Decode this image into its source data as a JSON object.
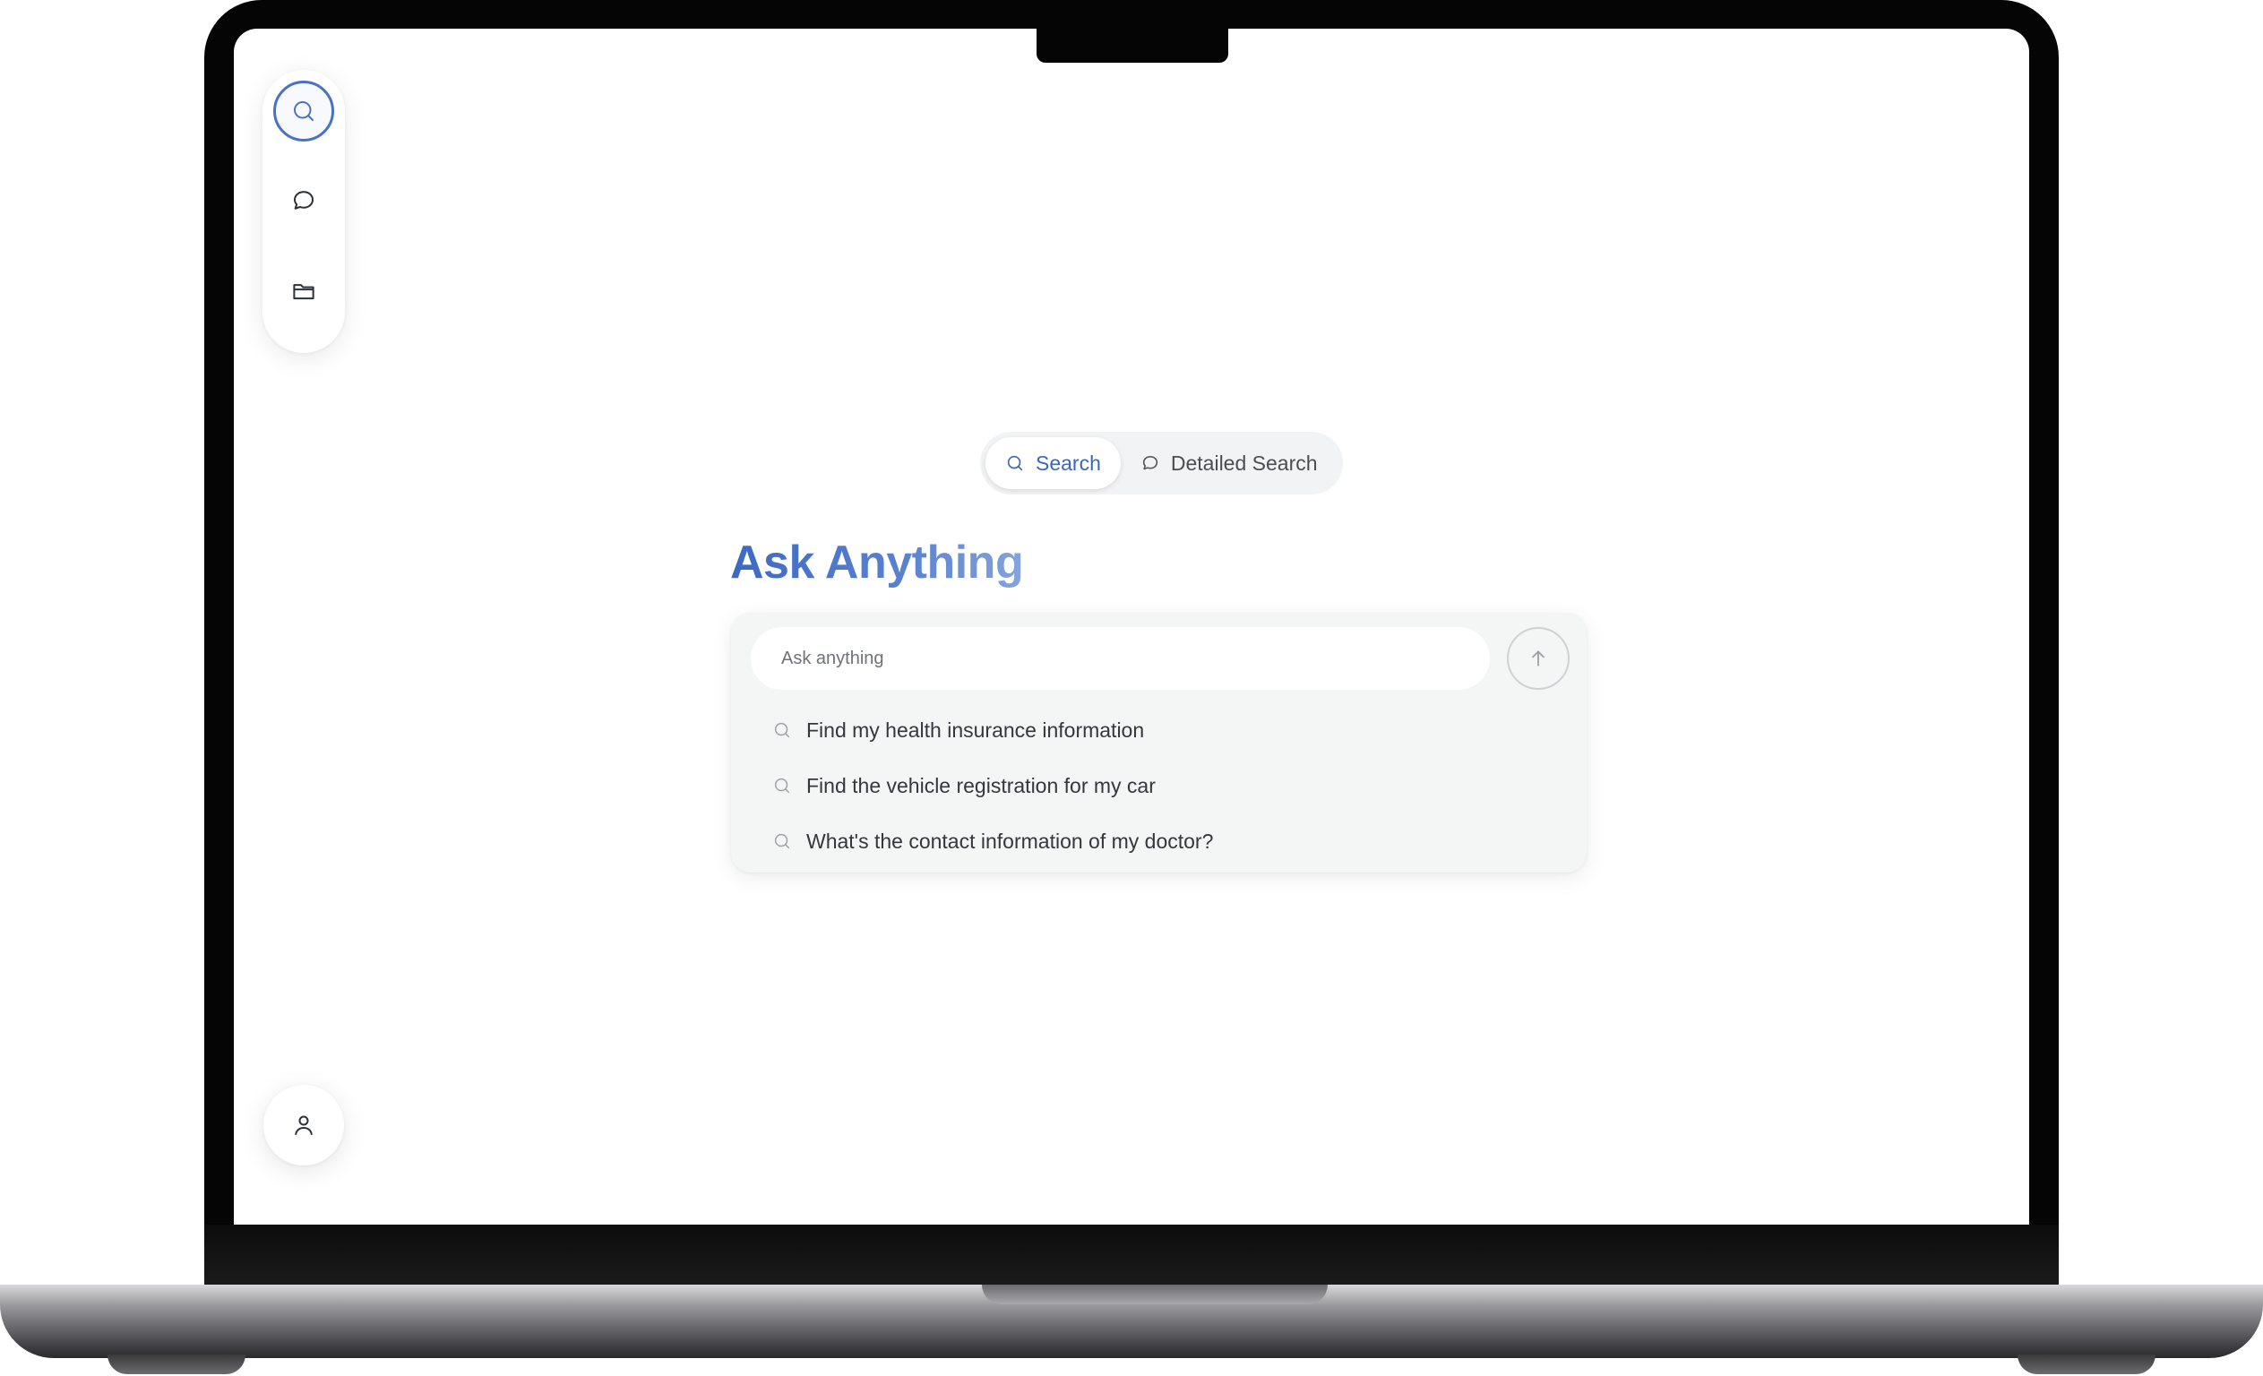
{
  "sidebar": {
    "items": [
      {
        "icon": "search-icon",
        "active": true
      },
      {
        "icon": "chat-bubble-icon",
        "active": false
      },
      {
        "icon": "folder-icon",
        "active": false
      }
    ],
    "profile_icon": "user-icon"
  },
  "mode_toggle": {
    "tabs": [
      {
        "label": "Search",
        "icon": "search-icon",
        "active": true
      },
      {
        "label": "Detailed Search",
        "icon": "chat-bubble-icon",
        "active": false
      }
    ]
  },
  "heading": "Ask Anything",
  "search": {
    "placeholder": "Ask anything",
    "value": "",
    "submit_icon": "arrow-up-icon"
  },
  "suggestions": [
    {
      "text": "Find my health insurance information",
      "icon": "search-icon"
    },
    {
      "text": "Find the vehicle registration for my car",
      "icon": "search-icon"
    },
    {
      "text": "What's the contact information of my doctor?",
      "icon": "search-icon"
    }
  ],
  "colors": {
    "accent": "#4a72c4",
    "heading_gradient_start": "#3d69c2",
    "heading_gradient_end": "#86a4dc",
    "panel_background": "#f4f5f5",
    "frame": "#050505"
  }
}
